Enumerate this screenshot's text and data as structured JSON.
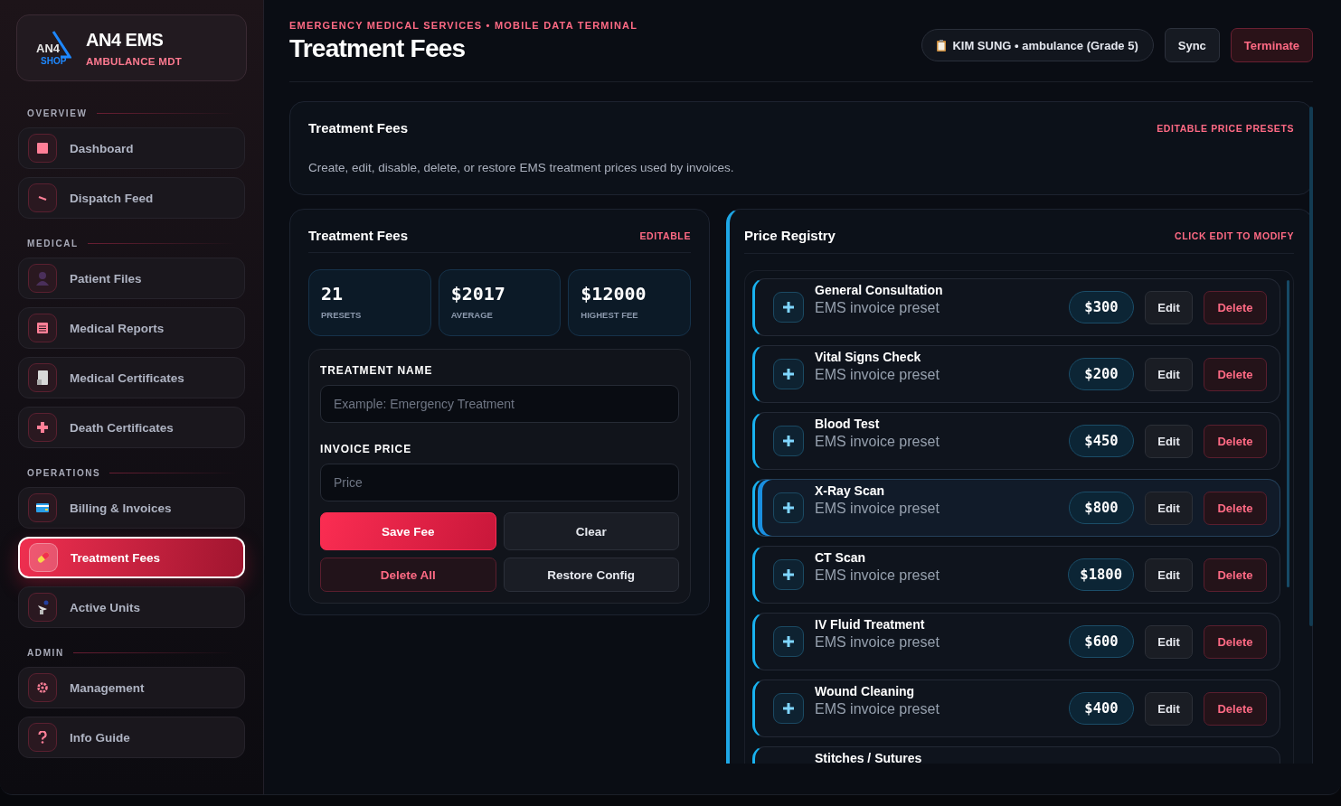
{
  "brand": {
    "name": "AN4 EMS",
    "subtitle": "AMBULANCE MDT",
    "logo_text": "AN4",
    "logo_sub": "SHOP"
  },
  "sidebar": {
    "sections": [
      {
        "label": "OVERVIEW",
        "items": [
          {
            "label": "Dashboard",
            "selected": false
          },
          {
            "label": "Dispatch Feed",
            "selected": false
          }
        ]
      },
      {
        "label": "MEDICAL",
        "items": [
          {
            "label": "Patient Files",
            "selected": false
          },
          {
            "label": "Medical Reports",
            "selected": false
          },
          {
            "label": "Medical Certificates",
            "selected": false
          },
          {
            "label": "Death Certificates",
            "selected": false
          }
        ]
      },
      {
        "label": "OPERATIONS",
        "items": [
          {
            "label": "Billing & Invoices",
            "selected": false
          },
          {
            "label": "Treatment Fees",
            "selected": true
          },
          {
            "label": "Active Units",
            "selected": false
          }
        ]
      },
      {
        "label": "ADMIN",
        "items": [
          {
            "label": "Management",
            "selected": false
          },
          {
            "label": "Info Guide",
            "selected": false
          }
        ]
      }
    ]
  },
  "header": {
    "eyebrow": "EMERGENCY MEDICAL SERVICES • MOBILE DATA TERMINAL",
    "title": "Treatment Fees",
    "user": "KIM SUNG • ambulance (Grade 5)",
    "buttons": [
      {
        "label": "Sync",
        "kind": "neutral"
      },
      {
        "label": "Terminate",
        "kind": "danger"
      }
    ]
  },
  "intro": {
    "title": "Treatment Fees",
    "tag": "EDITABLE PRICE PRESETS",
    "text": "Create, edit, disable, delete, or restore EMS treatment prices used by invoices."
  },
  "editor": {
    "title": "Treatment Fees",
    "tag": "EDITABLE",
    "stats": [
      {
        "value": "21",
        "label": "PRESETS"
      },
      {
        "value": "$2017",
        "label": "AVERAGE"
      },
      {
        "value": "$12000",
        "label": "HIGHEST FEE"
      }
    ],
    "fields": [
      {
        "label": "TREATMENT NAME",
        "placeholder": "Example: Emergency Treatment"
      },
      {
        "label": "INVOICE PRICE",
        "placeholder": "Price"
      }
    ],
    "buttons": [
      {
        "label": "Save Fee",
        "kind": "primary"
      },
      {
        "label": "Clear",
        "kind": "neutral"
      },
      {
        "label": "Delete All",
        "kind": "danger"
      },
      {
        "label": "Restore Config",
        "kind": "neutral"
      }
    ]
  },
  "registry": {
    "title": "Price Registry",
    "tag": "CLICK EDIT TO MODIFY",
    "rows": [
      {
        "name": "General Consultation",
        "note": "EMS invoice preset",
        "price": "$300",
        "actions": [
          "Edit",
          "Delete"
        ],
        "selected": false
      },
      {
        "name": "Vital Signs Check",
        "note": "EMS invoice preset",
        "price": "$200",
        "actions": [
          "Edit",
          "Delete"
        ],
        "selected": false
      },
      {
        "name": "Blood Test",
        "note": "EMS invoice preset",
        "price": "$450",
        "actions": [
          "Edit",
          "Delete"
        ],
        "selected": false
      },
      {
        "name": "X-Ray Scan",
        "note": "EMS invoice preset",
        "price": "$800",
        "actions": [
          "Edit",
          "Delete"
        ],
        "selected": true
      },
      {
        "name": "CT Scan",
        "note": "EMS invoice preset",
        "price": "$1800",
        "actions": [
          "Edit",
          "Delete"
        ],
        "selected": false
      },
      {
        "name": "IV Fluid Treatment",
        "note": "EMS invoice preset",
        "price": "$600",
        "actions": [
          "Edit",
          "Delete"
        ],
        "selected": false
      },
      {
        "name": "Wound Cleaning",
        "note": "EMS invoice preset",
        "price": "$400",
        "actions": [
          "Edit",
          "Delete"
        ],
        "selected": false
      },
      {
        "name": "Stitches / Sutures",
        "selected": false
      }
    ]
  }
}
